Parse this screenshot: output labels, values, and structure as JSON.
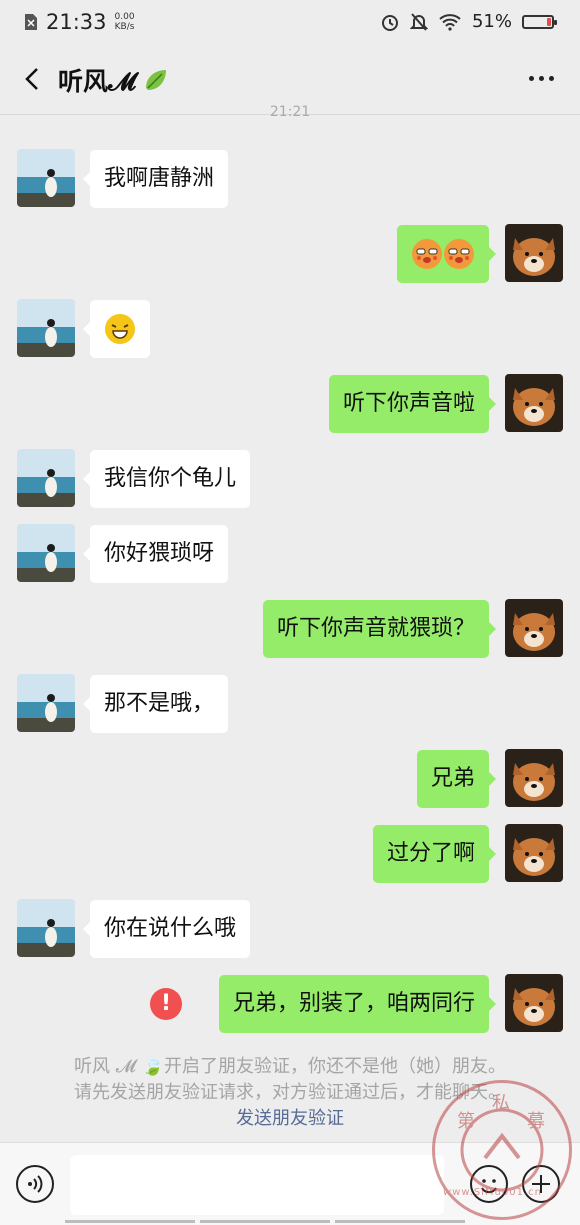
{
  "status_bar": {
    "time": "21:33",
    "net_speed": "0.00",
    "net_unit": "KB/s",
    "battery": "51%",
    "battery_level": 0.51
  },
  "header": {
    "title": "听风𝓜",
    "back_icon": "chevron-left-icon",
    "more_icon": "more-dots-icon"
  },
  "timestamp": "21:21",
  "messages": [
    {
      "side": "in",
      "text": "我啊唐静洲"
    },
    {
      "side": "out",
      "text": "",
      "emoji": [
        "hot-face",
        "hot-face"
      ]
    },
    {
      "side": "in",
      "text": "",
      "emoji": [
        "grin-face"
      ]
    },
    {
      "side": "out",
      "text": "听下你声音啦"
    },
    {
      "side": "in",
      "text": "我信你个龟儿"
    },
    {
      "side": "in",
      "text": "你好猥琐呀"
    },
    {
      "side": "out",
      "text": "听下你声音就猥琐？"
    },
    {
      "side": "in",
      "text": "那不是哦，"
    },
    {
      "side": "out",
      "text": "兄弟"
    },
    {
      "side": "out",
      "text": "过分了啊"
    },
    {
      "side": "in",
      "text": "你在说什么哦"
    },
    {
      "side": "out",
      "text": "兄弟，别装了，咱两同行",
      "failed": true
    }
  ],
  "notice": {
    "line1": "听风 𝓜 🍃开启了朋友验证，你还不是他（她）朋友。",
    "line2": "请先发送朋友验证请求，对方验证通过后，才能聊天。",
    "link": "发送朋友验证"
  },
  "watermark": {
    "chars": [
      "第",
      "私",
      "募"
    ],
    "url": "www.SiMu001.cn"
  },
  "input": {
    "placeholder": ""
  },
  "colors": {
    "outgoing": "#95ec69",
    "incoming": "#ffffff",
    "link": "#576b95",
    "error": "#f05050"
  }
}
